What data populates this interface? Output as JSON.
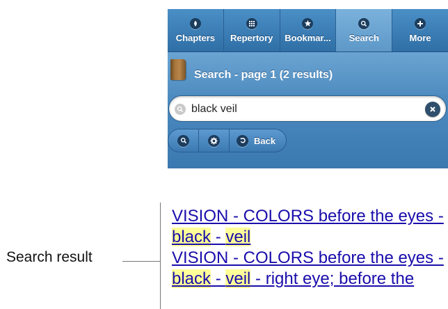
{
  "tabs": [
    {
      "label": "Chapters",
      "icon": "chapters-icon",
      "active": false
    },
    {
      "label": "Repertory",
      "icon": "grid-icon",
      "active": false
    },
    {
      "label": "Bookmar...",
      "icon": "star-icon",
      "active": false
    },
    {
      "label": "Search",
      "icon": "search-icon",
      "active": true
    },
    {
      "label": "More",
      "icon": "plus-icon",
      "active": false
    }
  ],
  "header": {
    "title": "Search - page 1 (2 results)",
    "icon": "book-icon"
  },
  "search": {
    "value": "black veil",
    "clear_icon": "clear-icon"
  },
  "toolbar": {
    "search_icon": "search-icon",
    "settings_icon": "gear-icon",
    "back_label": "Back",
    "back_icon": "back-arrow-icon"
  },
  "results": [
    {
      "prefix": "VISION - COLORS before the eyes - ",
      "term1": "black",
      "sep": " - ",
      "term2": "veil",
      "suffix": ""
    },
    {
      "prefix": "VISION - COLORS before the eyes - ",
      "term1": "black",
      "sep": " - ",
      "term2": "veil",
      "suffix": " - right eye; before the"
    }
  ],
  "annotation": {
    "label": "Search result"
  },
  "colors": {
    "tabbar": "#3a7db8",
    "header": "#5a98cc",
    "highlight": "#ffff99",
    "link": "#1a0dab"
  }
}
